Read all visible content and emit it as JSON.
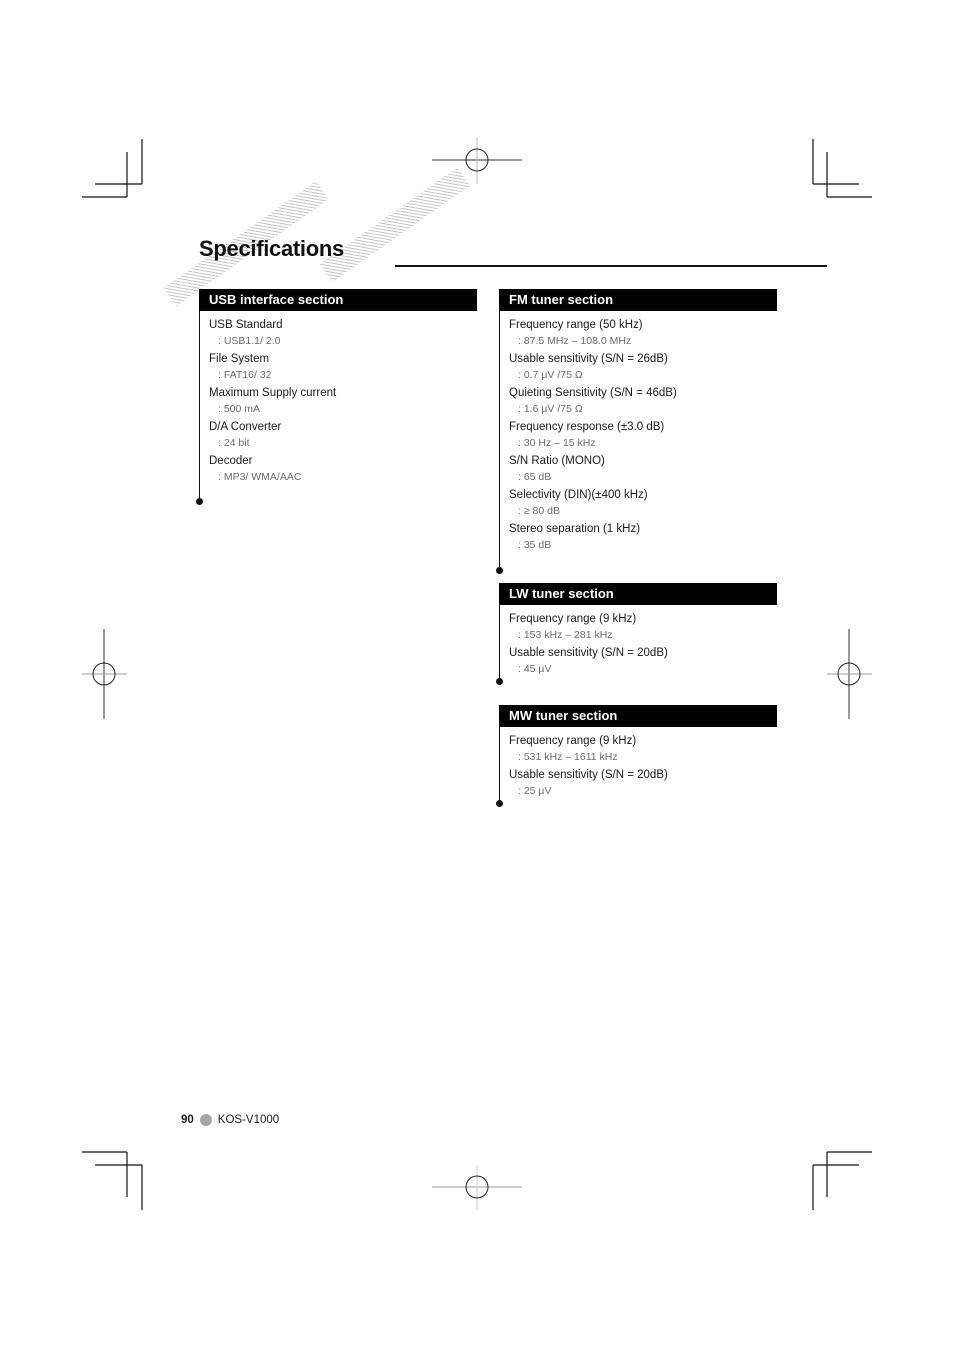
{
  "page": {
    "title": "Specifications",
    "footer": {
      "page_number": "90",
      "model": "KOS-V1000"
    }
  },
  "sections": {
    "usb": {
      "heading": "USB interface section",
      "specs": [
        {
          "label": "USB Standard",
          "value": ": USB1.1/ 2.0"
        },
        {
          "label": "File System",
          "value": ": FAT16/ 32"
        },
        {
          "label": "Maximum Supply current",
          "value": ": 500 mA"
        },
        {
          "label": "D/A Converter",
          "value": ": 24 bit"
        },
        {
          "label": "Decoder",
          "value": ": MP3/ WMA/AAC"
        }
      ]
    },
    "fm": {
      "heading": "FM tuner section",
      "specs": [
        {
          "label": "Frequency range (50 kHz)",
          "value": ": 87.5 MHz – 108.0 MHz"
        },
        {
          "label": "Usable sensitivity (S/N = 26dB)",
          "value": ": 0.7 µV  /75 Ω"
        },
        {
          "label": "Quieting Sensitivity (S/N = 46dB)",
          "value": ": 1.6 µV  /75 Ω"
        },
        {
          "label": "Frequency response (±3.0 dB)",
          "value": ": 30 Hz – 15 kHz"
        },
        {
          "label": "S/N Ratio (MONO)",
          "value": ": 65 dB"
        },
        {
          "label": "Selectivity (DIN)(±400 kHz)",
          "value": ": ≥ 80 dB"
        },
        {
          "label": "Stereo separation (1 kHz)",
          "value": ": 35 dB"
        }
      ]
    },
    "lw": {
      "heading": "LW tuner section",
      "specs": [
        {
          "label": "Frequency range (9 kHz)",
          "value": ": 153 kHz – 281 kHz"
        },
        {
          "label": "Usable sensitivity (S/N = 20dB)",
          "value": ": 45 µV"
        }
      ]
    },
    "mw": {
      "heading": "MW tuner section",
      "specs": [
        {
          "label": "Frequency range (9 kHz)",
          "value": ": 531 kHz – 1611 kHz"
        },
        {
          "label": "Usable sensitivity (S/N = 20dB)",
          "value": ": 25 µV"
        }
      ]
    }
  }
}
